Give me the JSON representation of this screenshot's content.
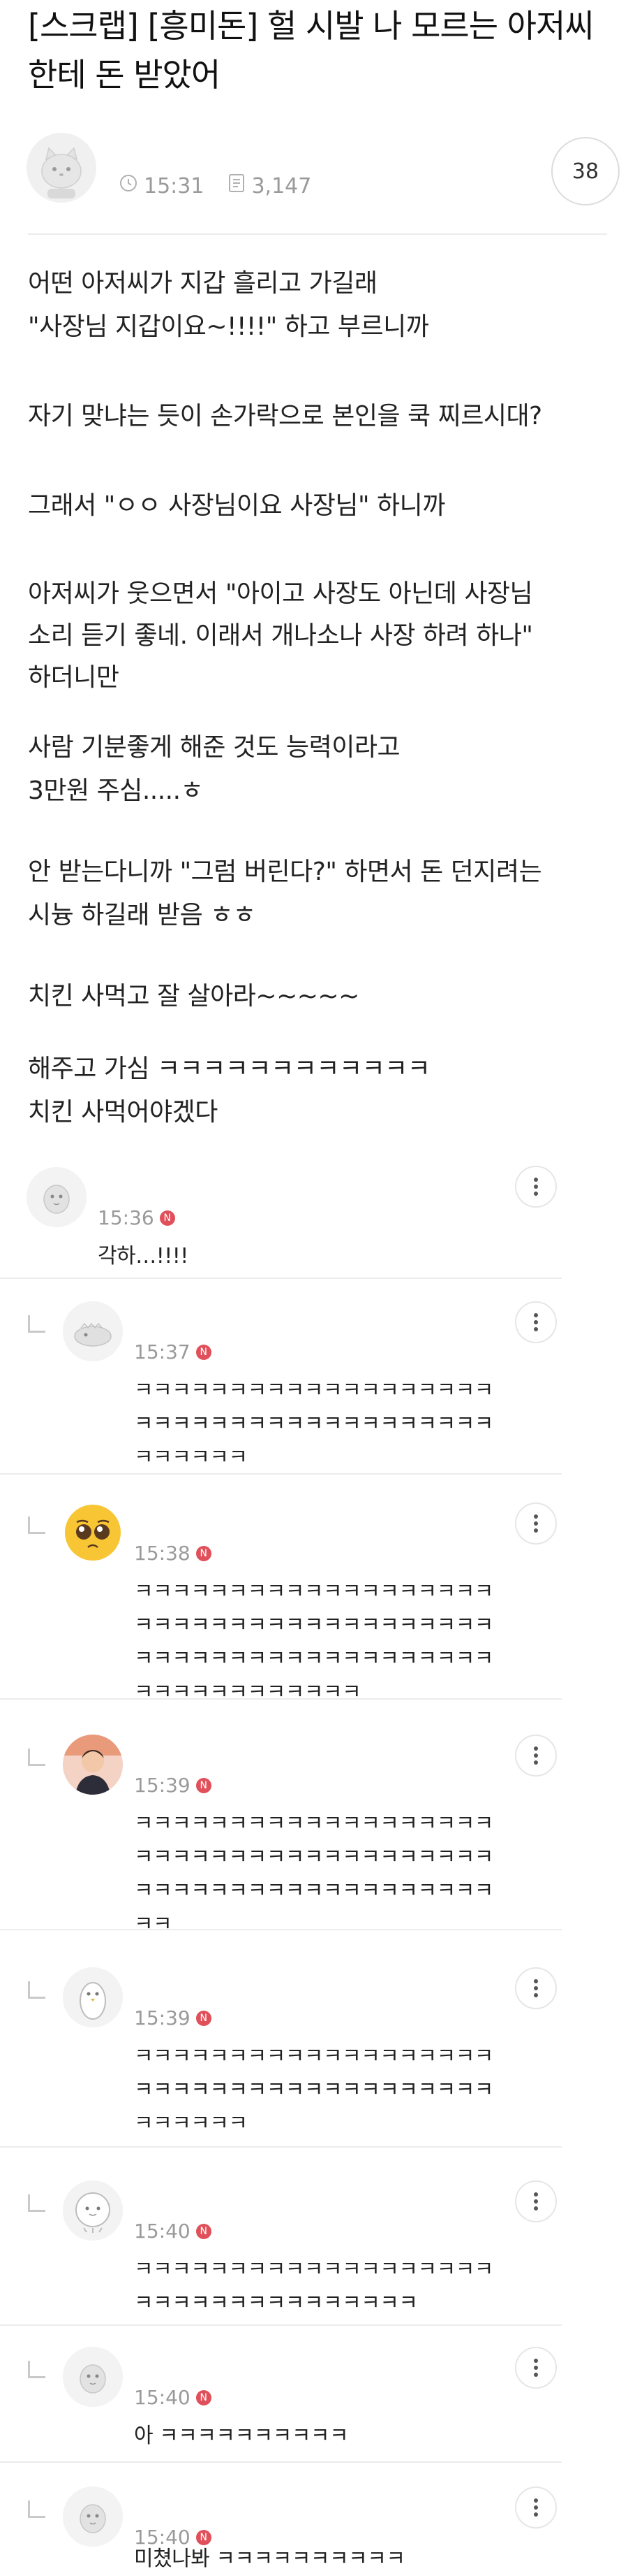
{
  "post": {
    "title": "[스크랩] [흥미돈] 헐 시발 나 모르는 아저씨한테 돈 받았어",
    "time": "15:31",
    "views": "3,147",
    "comment_count": "38",
    "body": [
      "어떤 아저씨가 지갑 흘리고 가길래",
      "\"사장님 지갑이요~!!!!\" 하고 부르니까",
      "자기 맞냐는 듯이 손가락으로 본인을 쿡 찌르시대?",
      "그래서 \"ㅇㅇ 사장님이요 사장님\" 하니까",
      "아저씨가 웃으면서 \"아이고 사장도 아닌데 사장님",
      "소리 듣기 좋네. 이래서 개나소나 사장 하려 하나\"",
      "하더니만",
      "사람 기분좋게 해준 것도 능력이라고",
      "3만원 주심.....ㅎ",
      "안 받는다니까 \"그럼 버린다?\" 하면서 돈 던지려는",
      "시늉 하길래 받음 ㅎㅎ",
      "치킨 사먹고 잘 살아라~~~~~",
      "해주고 가심 ㅋㅋㅋㅋㅋㅋㅋㅋㅋㅋㅋㅋ",
      "치킨 사먹어야겠다"
    ]
  },
  "comments": [
    {
      "time": "15:36",
      "badge": "N",
      "text": "각하…!!!!"
    },
    {
      "time": "15:37",
      "badge": "N",
      "text": "ㅋㅋㅋㅋㅋㅋㅋㅋㅋㅋㅋㅋㅋㅋㅋㅋㅋㅋㅋ\nㅋㅋㅋㅋㅋㅋㅋㅋㅋㅋㅋㅋㅋㅋㅋㅋㅋㅋㅋ\nㅋㅋㅋㅋㅋㅋ"
    },
    {
      "time": "15:38",
      "badge": "N",
      "text": "ㅋㅋㅋㅋㅋㅋㅋㅋㅋㅋㅋㅋㅋㅋㅋㅋㅋㅋㅋ\nㅋㅋㅋㅋㅋㅋㅋㅋㅋㅋㅋㅋㅋㅋㅋㅋㅋㅋㅋ\nㅋㅋㅋㅋㅋㅋㅋㅋㅋㅋㅋㅋㅋㅋㅋㅋㅋㅋㅋ\nㅋㅋㅋㅋㅋㅋㅋㅋㅋㅋㅋㅋ"
    },
    {
      "time": "15:39",
      "badge": "N",
      "text": "ㅋㅋㅋㅋㅋㅋㅋㅋㅋㅋㅋㅋㅋㅋㅋㅋㅋㅋㅋ\nㅋㅋㅋㅋㅋㅋㅋㅋㅋㅋㅋㅋㅋㅋㅋㅋㅋㅋㅋ\nㅋㅋㅋㅋㅋㅋㅋㅋㅋㅋㅋㅋㅋㅋㅋㅋㅋㅋㅋ\nㅋㅋ"
    },
    {
      "time": "15:39",
      "badge": "N",
      "text": "ㅋㅋㅋㅋㅋㅋㅋㅋㅋㅋㅋㅋㅋㅋㅋㅋㅋㅋㅋ\nㅋㅋㅋㅋㅋㅋㅋㅋㅋㅋㅋㅋㅋㅋㅋㅋㅋㅋㅋ\nㅋㅋㅋㅋㅋㅋ"
    },
    {
      "time": "15:40",
      "badge": "N",
      "text": "ㅋㅋㅋㅋㅋㅋㅋㅋㅋㅋㅋㅋㅋㅋㅋㅋㅋㅋㅋ\nㅋㅋㅋㅋㅋㅋㅋㅋㅋㅋㅋㅋㅋㅋㅋ"
    },
    {
      "time": "15:40",
      "badge": "N",
      "text": "아 ㅋㅋㅋㅋㅋㅋㅋㅋㅋㅋ"
    },
    {
      "time": "15:40",
      "badge": "N",
      "text": "미쳤나봐 ㅋㅋㅋㅋㅋㅋㅋㅋㅋㅋ"
    }
  ],
  "icons": {
    "clock": "clock-icon",
    "views": "document-icon",
    "more": "more-vertical-icon",
    "reply": "reply-arrow-icon"
  },
  "colors": {
    "new_badge": "#e0505a",
    "meta_gray": "#9a9a9a",
    "divider": "#ececec"
  }
}
